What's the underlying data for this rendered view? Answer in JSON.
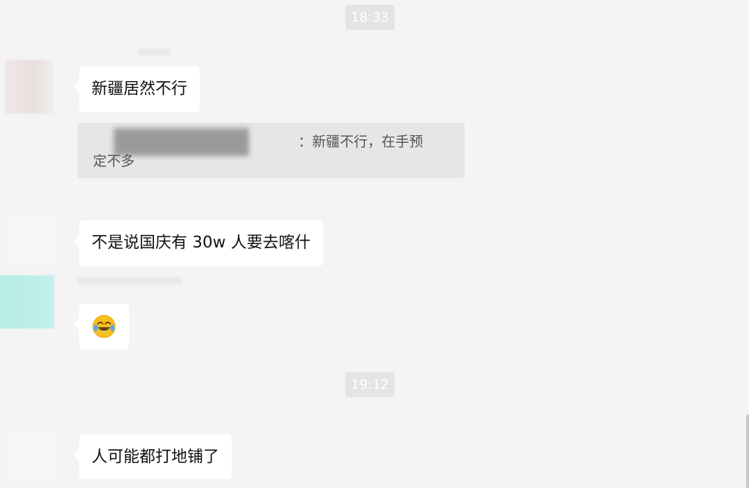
{
  "timestamps": [
    "18:33",
    "19:12"
  ],
  "messages": [
    {
      "text": "新疆居然不行"
    },
    {
      "text": "不是说国庆有 30w 人要去喀什"
    },
    {
      "emoji": "crying-laughing-emoji"
    },
    {
      "text": "人可能都打地铺了"
    }
  ],
  "quote": {
    "line1": "：新疆不行，在手预",
    "line2": "定不多"
  },
  "colors": {
    "background": "#f4f4f4",
    "bubble": "#ffffff",
    "quote": "#e6e6e6",
    "timestamp_bg": "#e4e4e4"
  }
}
